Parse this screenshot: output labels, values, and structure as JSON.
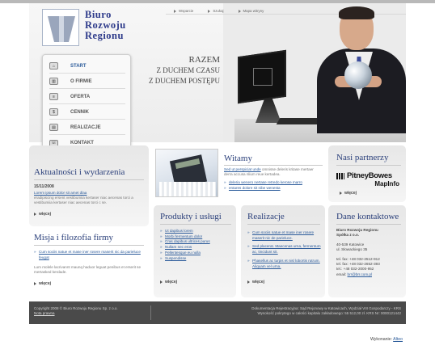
{
  "logo": {
    "line1": "Biuro",
    "line2": "Rozwoju",
    "line3": "Regionu"
  },
  "toplinks": [
    "Wsparcie",
    "Szukaj",
    "Mapa witryny"
  ],
  "menu": [
    {
      "label": "START",
      "icon": "home-icon"
    },
    {
      "label": "O FIRMIE",
      "icon": "building-icon"
    },
    {
      "label": "OFERTA",
      "icon": "document-icon"
    },
    {
      "label": "CENNIK",
      "icon": "dollar-icon"
    },
    {
      "label": "REALIZACJE",
      "icon": "chart-icon"
    },
    {
      "label": "KONTAKT",
      "icon": "phone-icon"
    }
  ],
  "slogan": {
    "line1": "RAZEM",
    "line2": "Z DUCHEM CZASU",
    "line3": "Z DUCHEM POSTĘPU"
  },
  "news": {
    "title": "Aktualności i wydarzenia",
    "date": "15/11/2008",
    "link": "Lorem ipsum dolor sit amet dlaa",
    "text": "eradipiscing ersent vestibumiia kertaser niac aecenas torci a vestibumiia kertaser niac aecenas torci c se.",
    "more": "więcej"
  },
  "mission": {
    "title": "Misja i filozofia firmy",
    "link": "Cum sociis natue et mase iner rosere maserit nic da parieluce feugat",
    "text": "Lum molele lacrivannt maunq haduor leguat penibus et erserit se mertasked kerdade.",
    "more": "więcej"
  },
  "welcome": {
    "title": "Witamy",
    "intro_link": "Sed ut perspiciat unde",
    "intro_text": "omnisse deleris kritase mertaer derra accusa nlium reue kertadea.",
    "items": [
      "deleria wenero nertase retredo kerose marro",
      "entares dolore sit nibe wenesta"
    ]
  },
  "products": {
    "title": "Produkty i usługi",
    "items": [
      "Ut dapibus lorem",
      "Morbi fermentum dolor",
      "Cras dapibus ultrices purus",
      "Nullam nec eros",
      "Pellentesque eu nulla",
      "Suspendisse"
    ],
    "more": "więcej"
  },
  "projects": {
    "title": "Realizacje",
    "items": [
      "Cum sociis natue et mase iner rosere maserit nic de parieluce.",
      "Sed placerat. Maecenas urna, fermentum ac, tincidunt sit.",
      "Phasellus ac turpis et nisl lobortis rutrum. Aliquam vel urna."
    ],
    "more": "więcej"
  },
  "partners": {
    "title": "Nasi partnerzy",
    "brand_line1": "PitneyBowes",
    "brand_line2": "MapInfo",
    "more": "więcej"
  },
  "contact": {
    "title": "Dane kontaktowe",
    "company1": "Biuro Rozwoju Regionu",
    "company2": "Spółka z o.o.",
    "addr1": "40-539 Katowice",
    "addr2": "ul. Słowackiego 35",
    "tel": "tel.  fax: +48 032-2512-912",
    "fax": "tel.  fax: +48 032-2652-393",
    "tel2": "tel.: +48 032-2000-952",
    "email_label": "email:",
    "email": "brr@brr.com.pl"
  },
  "footer": {
    "copyright": "Copyright 2008 © Biuro Rozwoju Regionu Sp. z o.o.",
    "privacy": "Nota prawna",
    "reg1": "Dokumentacja Rejestracyjna: Sąd Rejonowy w Katowicach, Wydział VIII Gospodarczy - KRS",
    "reg2": "Wysokość pokrytego w całości kapitału zakładowego: 55 512,00 zł. KRS Nr: 0000121442"
  },
  "wykonanie": {
    "label": "Wykonanie:",
    "link": "Alteo"
  }
}
